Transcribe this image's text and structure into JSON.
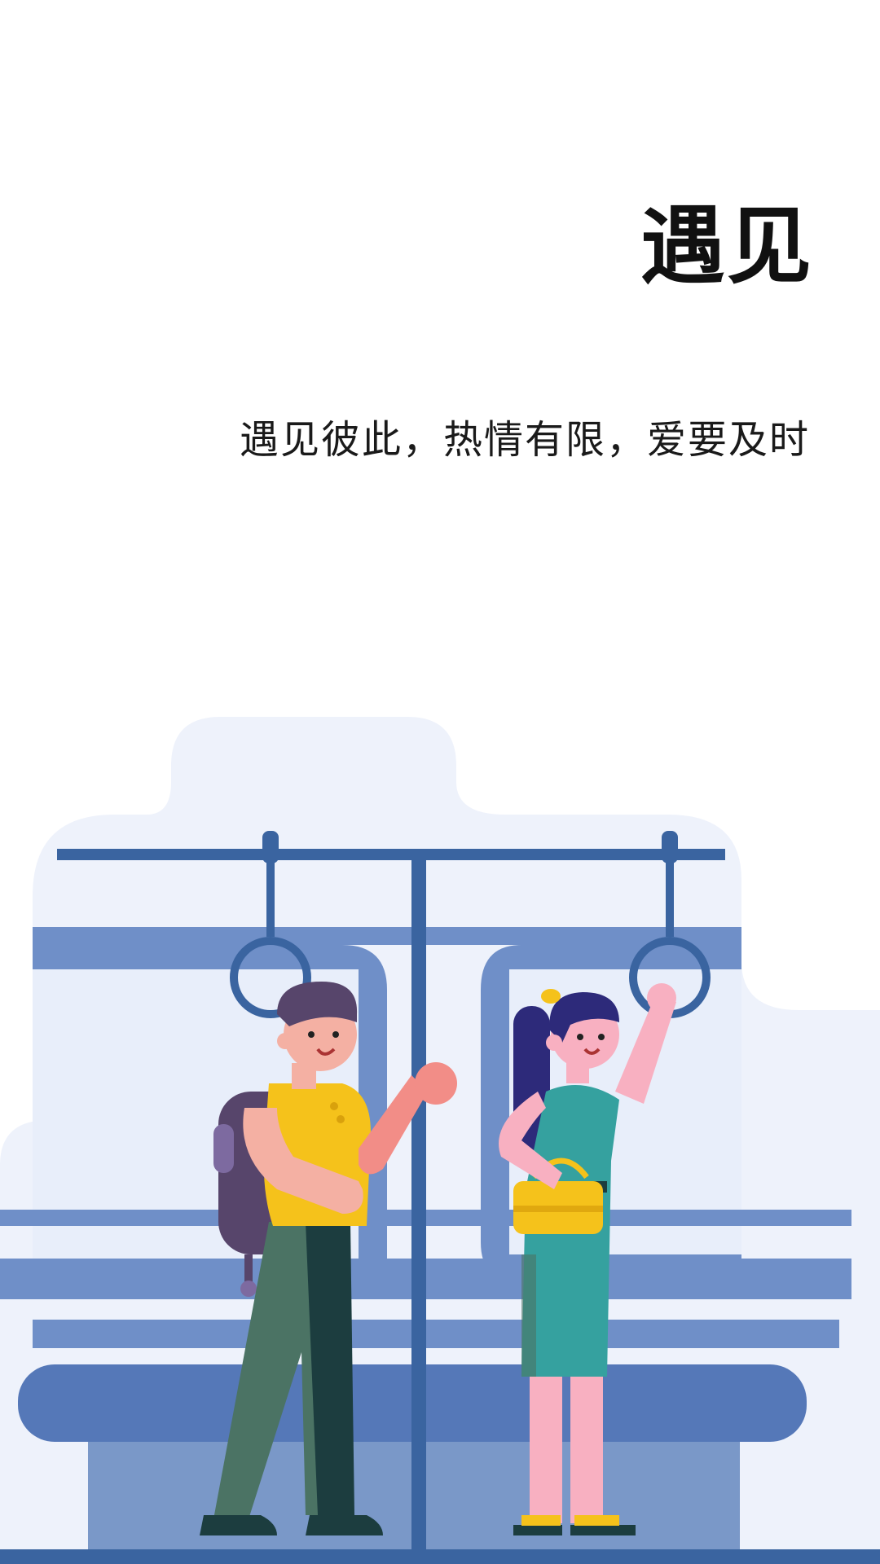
{
  "splash": {
    "title": "遇见",
    "slogan": "遇见彼此，热情有限，爱要及时"
  },
  "colors": {
    "background": "#ffffff",
    "cloud": "#eef2fb",
    "train_light": "#6f8fc8",
    "train_dark": "#3a64a0",
    "man_shirt": "#f5c21b",
    "woman_dress": "#35a19f"
  },
  "illustration": {
    "icon": "subway-commuters-illustration"
  }
}
